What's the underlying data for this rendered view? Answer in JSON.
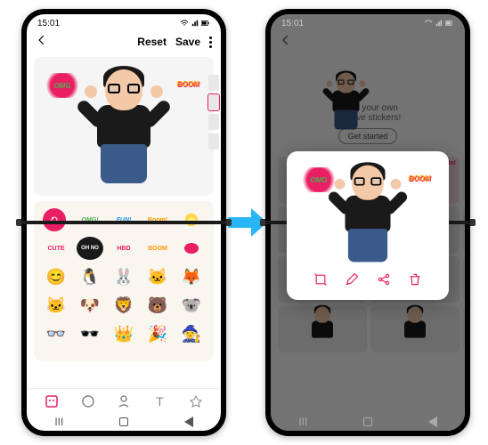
{
  "left": {
    "status": {
      "time": "15:01"
    },
    "header": {
      "reset": "Reset",
      "save": "Save"
    },
    "canvas": {
      "omg": "OMG",
      "boom": "BOOM"
    },
    "stickers": {
      "row1": [
        "",
        "OMG!",
        "FUN!",
        "Boom!",
        ""
      ],
      "row2": [
        "CUTE",
        "OH NO",
        "HBD",
        "BOOM",
        ""
      ],
      "row3_emoji": [
        "😊",
        "🐧",
        "🐰",
        "🐱",
        "🦊"
      ],
      "row4_emoji": [
        "🐱",
        "🐶",
        "🦁",
        "🐻",
        "🐨"
      ],
      "row5_emoji": [
        "👓",
        "🕶️",
        "👑",
        "🎉",
        "🧙"
      ]
    }
  },
  "right": {
    "status": {
      "time": "15:01"
    },
    "promo": {
      "line1": "Make your own",
      "line2": "creative stickers!",
      "cta": "Get started"
    },
    "cells": {
      "no_label": "No!"
    },
    "popup": {
      "omg": "OMG",
      "boom": "BOOM"
    }
  }
}
